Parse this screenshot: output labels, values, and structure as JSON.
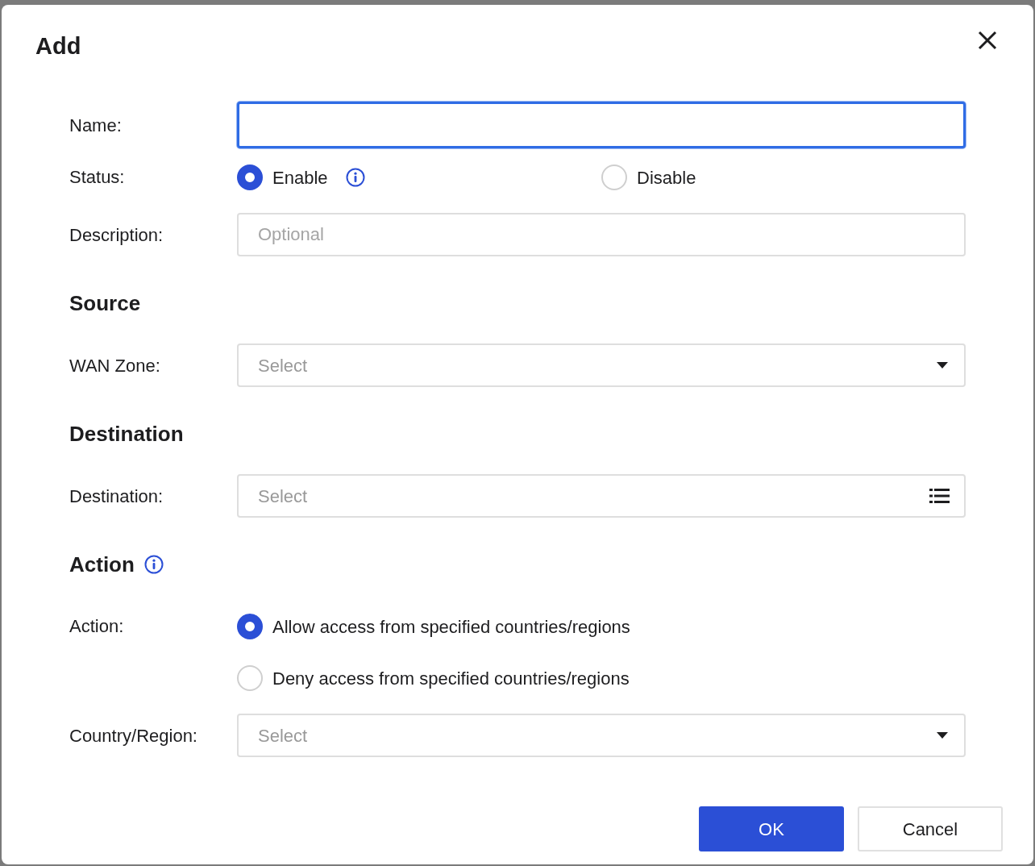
{
  "dialog": {
    "title": "Add"
  },
  "fields": [
    {
      "kind": "text",
      "label": "Name:",
      "focused": true
    },
    {
      "kind": "radio",
      "label": "Status:",
      "stacked": false,
      "options": [
        {
          "label": "Enable",
          "selected": true,
          "info": true
        },
        {
          "label": "Disable",
          "selected": false,
          "info": false
        }
      ]
    },
    {
      "kind": "text",
      "label": "Description:",
      "placeholder": "Optional",
      "focused": false
    },
    {
      "kind": "heading",
      "label": "Source",
      "info": false
    },
    {
      "kind": "select",
      "label": "WAN Zone:",
      "placeholder": "Select"
    },
    {
      "kind": "heading",
      "label": "Destination",
      "info": false
    },
    {
      "kind": "picker",
      "label": "Destination:",
      "placeholder": "Select"
    },
    {
      "kind": "heading",
      "label": "Action",
      "info": true
    },
    {
      "kind": "radio",
      "label": "Action:",
      "stacked": true,
      "options": [
        {
          "label": "Allow access from specified countries/regions",
          "selected": true,
          "info": false
        },
        {
          "label": "Deny access from specified countries/regions",
          "selected": false,
          "info": false
        }
      ]
    },
    {
      "kind": "select",
      "label": "Country/Region:",
      "placeholder": "Select"
    }
  ],
  "buttons": [
    {
      "label": "OK",
      "primary": true
    },
    {
      "label": "Cancel",
      "primary": false
    }
  ]
}
